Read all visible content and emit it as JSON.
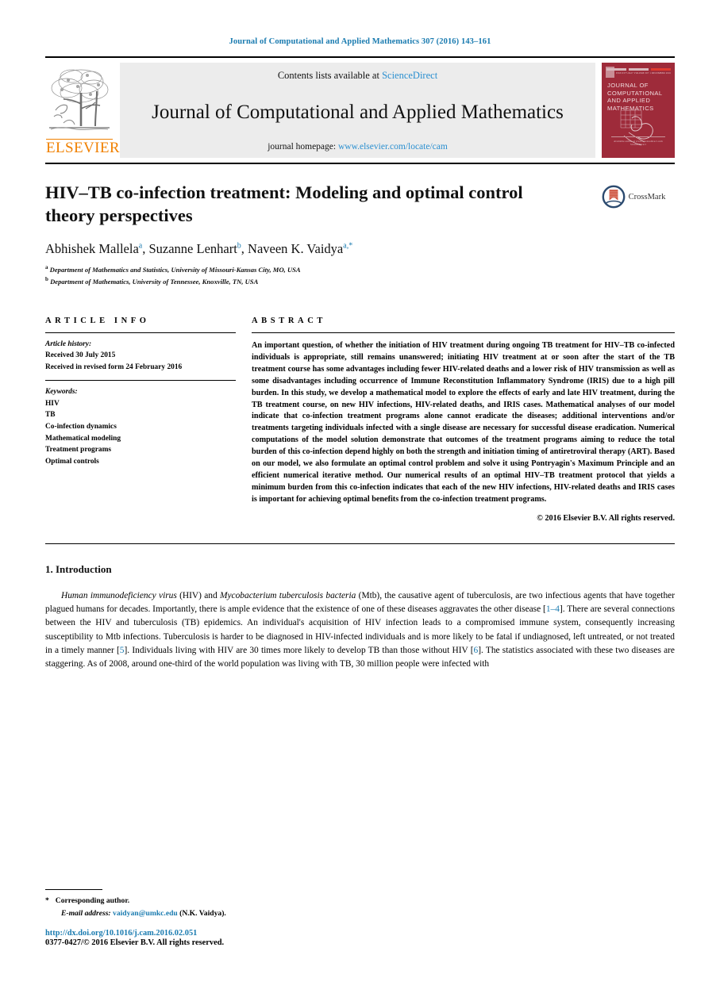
{
  "running_head": "Journal of Computational and Applied Mathematics 307 (2016) 143–161",
  "masthead": {
    "publisher_name": "ELSEVIER",
    "contents_prefix": "Contents lists available at ",
    "contents_link": "ScienceDirect",
    "journal_title": "Journal of Computational and Applied Mathematics",
    "homepage_prefix": "journal homepage: ",
    "homepage_link": "www.elsevier.com/locate/cam",
    "cover": {
      "title": "JOURNAL OF COMPUTATIONAL AND APPLIED MATHEMATICS",
      "label_left": "ISSN 0377-0427",
      "label_mid": "VOLUME 307",
      "label_right": "1 DECEMBER 2016",
      "foot_line1": "Available online at www.sciencedirect.com",
      "foot_line2": "ScienceDirect"
    }
  },
  "article": {
    "title": "HIV–TB co-infection treatment: Modeling and optimal control theory perspectives",
    "authors_plain": "Abhishek Mallela a, Suzanne Lenhart b, Naveen K. Vaidya a,*",
    "author_parts": {
      "a1_name": "Abhishek Mallela",
      "a1_sup": "a",
      "a2_name": "Suzanne Lenhart",
      "a2_sup": "b",
      "a3_name": "Naveen K. Vaidya",
      "a3_sup": "a,",
      "a3_star": "*"
    },
    "affiliations": [
      {
        "sup": "a",
        "text": "Department of Mathematics and Statistics, University of Missouri-Kansas City, MO, USA"
      },
      {
        "sup": "b",
        "text": "Department of Mathematics, University of Tennessee, Knoxville, TN, USA"
      }
    ],
    "crossmark_label": "CrossMark"
  },
  "article_info": {
    "heading": "ARTICLE INFO",
    "history_label": "Article history:",
    "history": [
      "Received 30 July 2015",
      "Received in revised form 24 February 2016"
    ],
    "keywords_label": "Keywords:",
    "keywords": [
      "HIV",
      "TB",
      "Co-infection dynamics",
      "Mathematical modeling",
      "Treatment programs",
      "Optimal controls"
    ]
  },
  "abstract": {
    "heading": "ABSTRACT",
    "text": "An important question, of whether the initiation of HIV treatment during ongoing TB treatment for HIV–TB co-infected individuals is appropriate, still remains unanswered; initiating HIV treatment at or soon after the start of the TB treatment course has some advantages including fewer HIV-related deaths and a lower risk of HIV transmission as well as some disadvantages including occurrence of Immune Reconstitution Inflammatory Syndrome (IRIS) due to a high pill burden. In this study, we develop a mathematical model to explore the effects of early and late HIV treatment, during the TB treatment course, on new HIV infections, HIV-related deaths, and IRIS cases. Mathematical analyses of our model indicate that co-infection treatment programs alone cannot eradicate the diseases; additional interventions and/or treatments targeting individuals infected with a single disease are necessary for successful disease eradication. Numerical computations of the model solution demonstrate that outcomes of the treatment programs aiming to reduce the total burden of this co-infection depend highly on both the strength and initiation timing of antiretroviral therapy (ART). Based on our model, we also formulate an optimal control problem and solve it using Pontryagin's Maximum Principle and an efficient numerical iterative method. Our numerical results of an optimal HIV–TB treatment protocol that yields a minimum burden from this co-infection indicates that each of the new HIV infections, HIV-related deaths and IRIS cases is important for achieving optimal benefits from the co-infection treatment programs.",
    "copyright": "© 2016 Elsevier B.V. All rights reserved."
  },
  "introduction": {
    "heading": "1. Introduction",
    "lead_italic": "Human immunodeficiency virus",
    "para_1a": " (HIV) and ",
    "lead_italic2": "Mycobacterium tuberculosis bacteria",
    "para_1b": " (Mtb), the causative agent of tuberculosis, are two infectious agents that have together plagued humans for decades. Importantly, there is ample evidence that the existence of one of these diseases aggravates the other disease [",
    "ref_1": "1–4",
    "para_1c": "]. There are several connections between the HIV and tuberculosis (TB) epidemics. An individual's acquisition of HIV infection leads to a compromised immune system, consequently increasing susceptibility to Mtb infections. Tuberculosis is harder to be diagnosed in HIV-infected individuals and is more likely to be fatal if undiagnosed, left untreated, or not treated in a timely manner [",
    "ref_2": "5",
    "para_1d": "]. Individuals living with HIV are 30 times more likely to develop TB than those without HIV [",
    "ref_3": "6",
    "para_1e": "]. The statistics associated with these two diseases are staggering. As of 2008, around one-third of the world population was living with TB, 30 million people were infected with"
  },
  "footer": {
    "star": "*",
    "corresponding": "Corresponding author.",
    "email_label": "E-mail address:",
    "email": "vaidyan@umkc.edu",
    "email_owner": "(N.K. Vaidya).",
    "doi": "http://dx.doi.org/10.1016/j.cam.2016.02.051",
    "issn": "0377-0427/© 2016 Elsevier B.V. All rights reserved."
  },
  "colors": {
    "link": "#1a7bb0",
    "sciencedirect": "#2a8fd0",
    "elsevier_orange": "#f08000",
    "cover_maroon": "#9e2b3a",
    "crossmark_blue": "#2b4a6f",
    "crossmark_red": "#c8402a"
  }
}
